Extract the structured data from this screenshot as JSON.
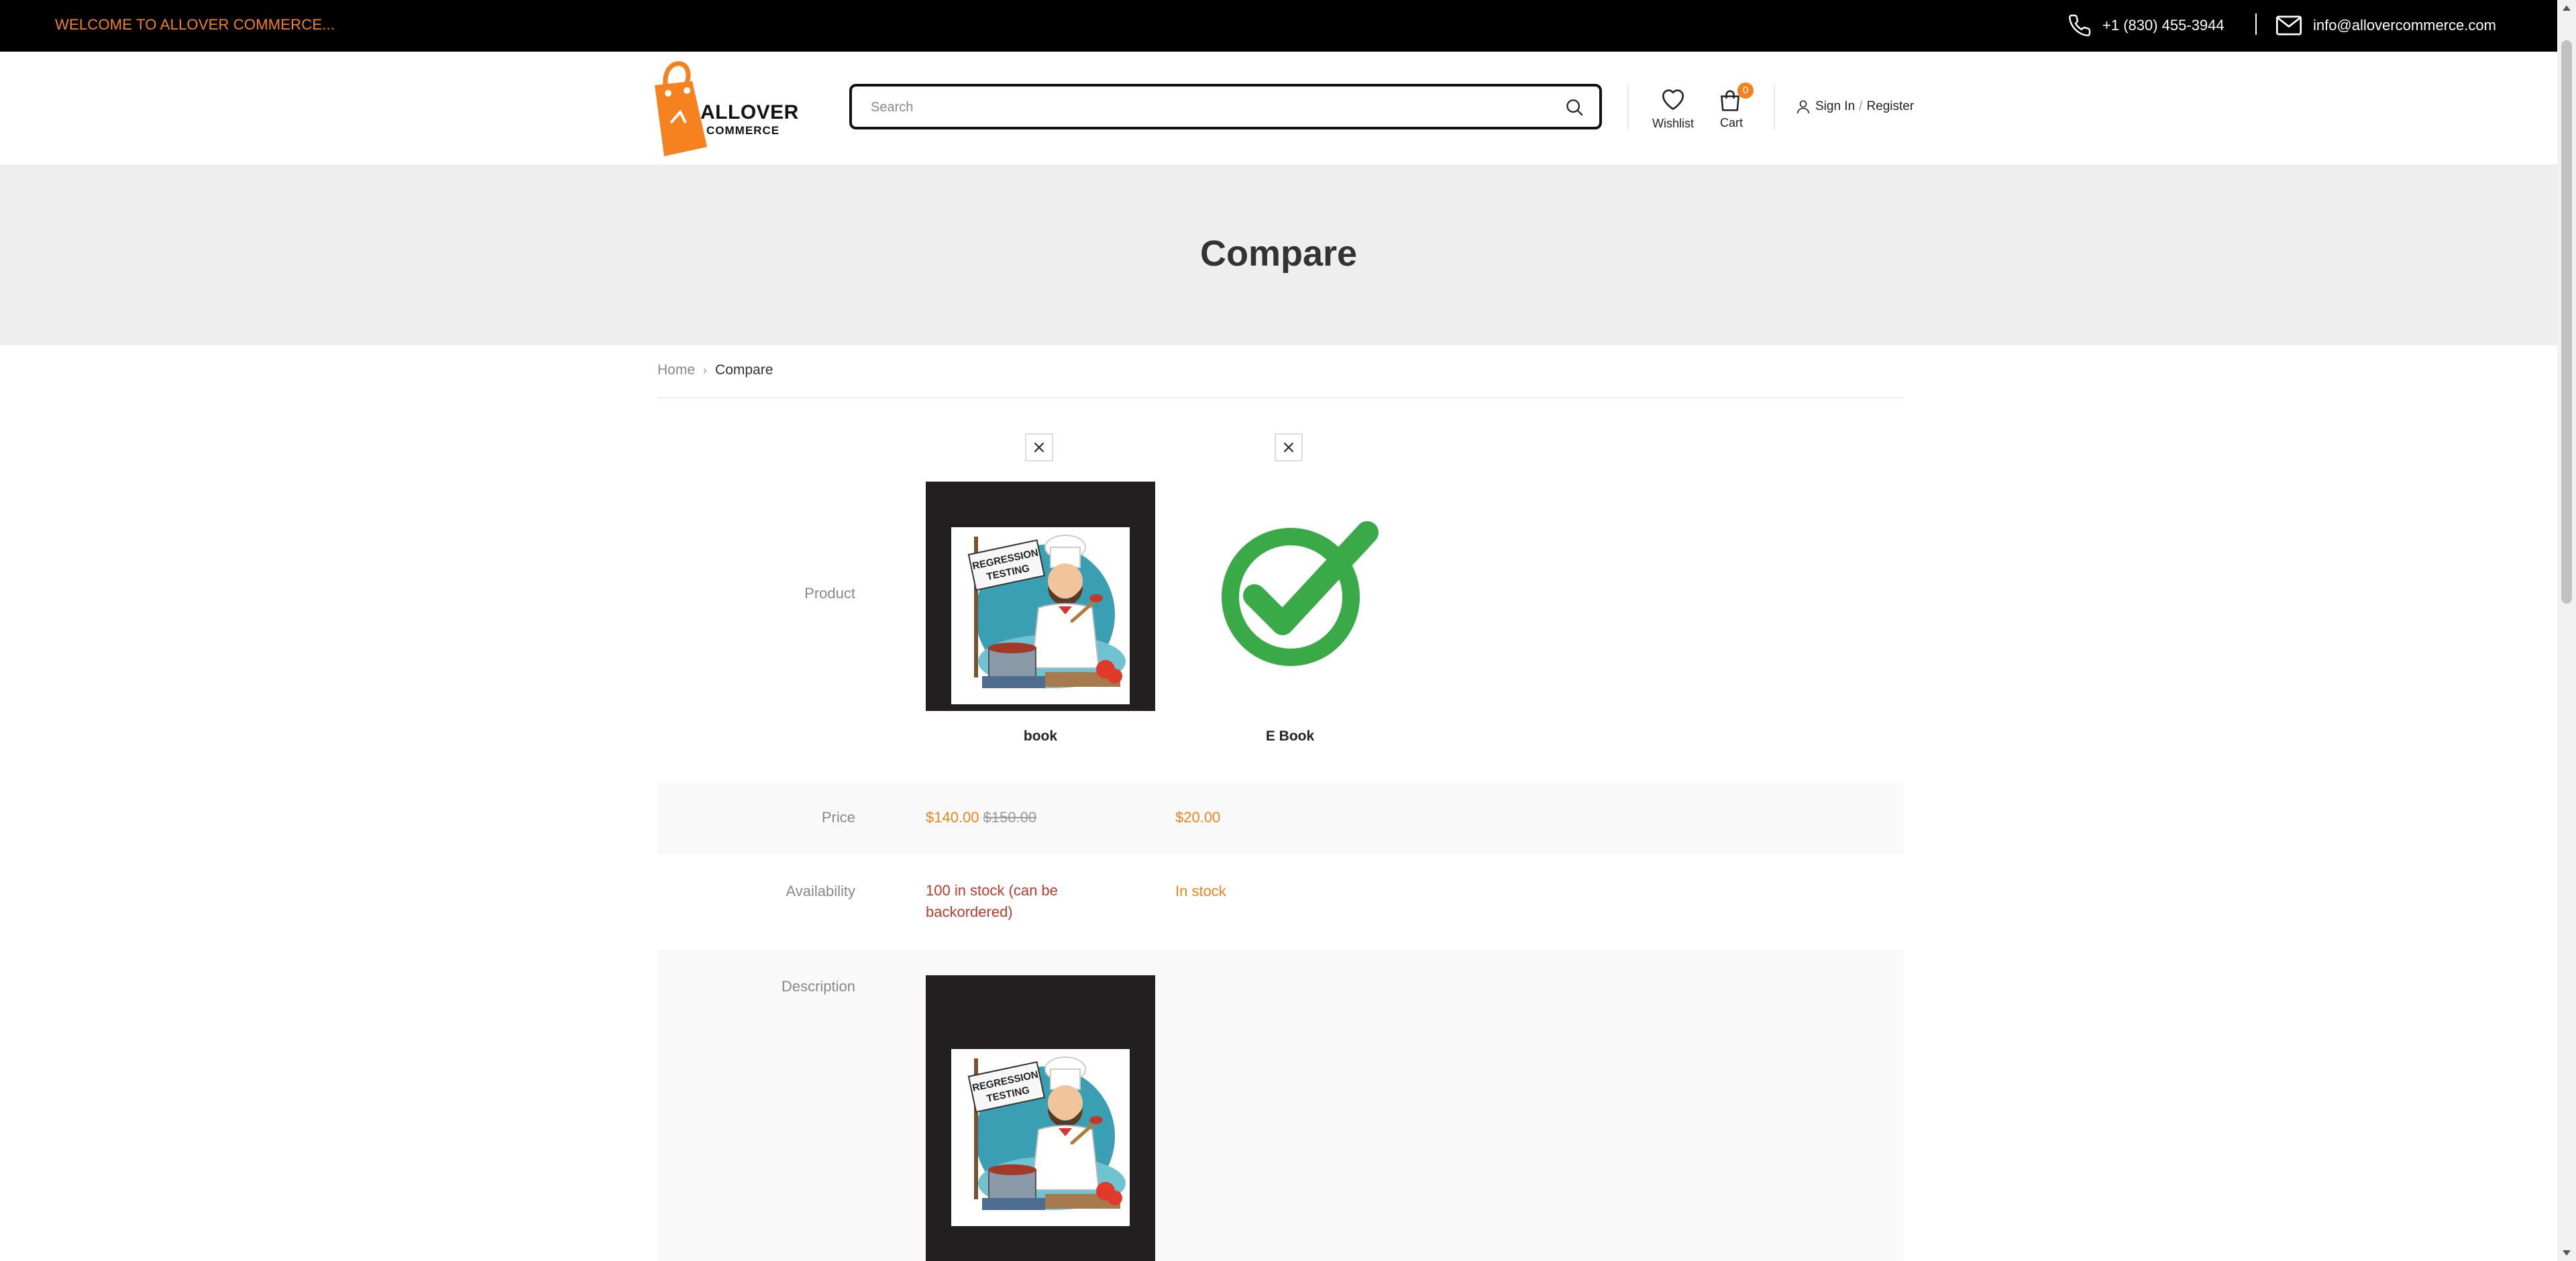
{
  "topbar": {
    "welcome": "WELCOME TO ALLOVER COMMERCE...",
    "phone": "+1 (830) 455-3944",
    "email": "info@allovercommerce.com"
  },
  "header": {
    "logo_line1": "ALLOVER",
    "logo_line2": "COMMERCE",
    "search_placeholder": "Search",
    "wishlist_label": "Wishlist",
    "cart_label": "Cart",
    "cart_count": "0",
    "sign_in": "Sign In",
    "separator": "/",
    "register": "Register"
  },
  "page": {
    "title": "Compare"
  },
  "breadcrumb": {
    "home": "Home",
    "current": "Compare"
  },
  "compare": {
    "labels": {
      "product": "Product",
      "price": "Price",
      "availability": "Availability",
      "description": "Description"
    },
    "image_texts": {
      "regression_line1": "REGRESSION",
      "regression_line2": "TESTING"
    },
    "products": [
      {
        "name": "book",
        "price_current": "$140.00",
        "price_old": "$150.00",
        "availability": "100 in stock (can be backordered)"
      },
      {
        "name": "E Book",
        "price_current": "$20.00",
        "availability": "In stock"
      }
    ]
  },
  "colors": {
    "accent": "#f5821f",
    "topbar_bg": "#000000",
    "title_band_bg": "#eeeeee",
    "in_stock_backorder": "#c0392b",
    "check_green": "#3aaa48"
  }
}
